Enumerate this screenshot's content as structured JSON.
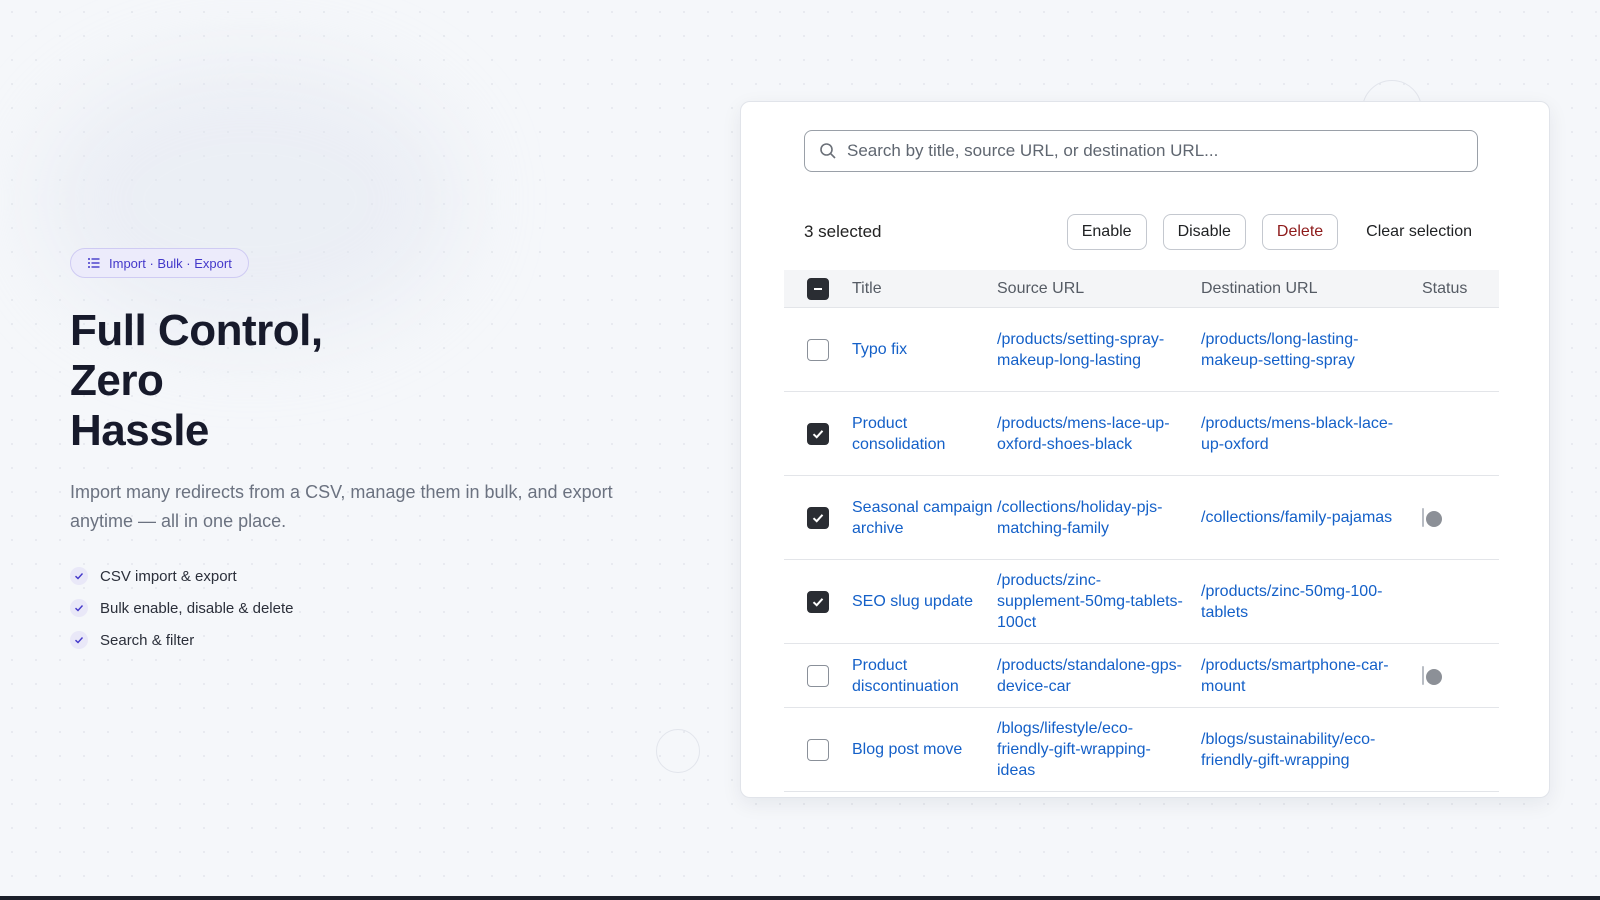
{
  "hero": {
    "chip_label": "Import · Bulk · Export",
    "chip_icon": "list-icon",
    "headline_lines": [
      "Full Control,",
      "Zero",
      "Hassle"
    ],
    "subtitle": "Import many redirects from a CSV, manage them in bulk, and export anytime — all in one place.",
    "features": [
      "CSV import & export",
      "Bulk enable, disable & delete",
      "Search & filter"
    ]
  },
  "search": {
    "placeholder": "Search by title, source URL, or destination URL..."
  },
  "bulk": {
    "selected_text": "3 selected",
    "enable_label": "Enable",
    "disable_label": "Disable",
    "delete_label": "Delete",
    "clear_label": "Clear selection"
  },
  "table": {
    "headers": {
      "title": "Title",
      "source": "Source URL",
      "destination": "Destination URL",
      "status": "Status"
    },
    "header_checkbox": "indeterminate",
    "rows": [
      {
        "title": "Typo fix",
        "source": "/products/setting-spray-makeup-long-lasting",
        "destination": "/products/long-lasting-makeup-setting-spray",
        "selected": false,
        "enabled": true
      },
      {
        "title": "Product consolidation",
        "source": "/products/mens-lace-up-oxford-shoes-black",
        "destination": "/products/mens-black-lace-up-oxford",
        "selected": true,
        "enabled": true
      },
      {
        "title": "Seasonal campaign archive",
        "source": "/collections/holiday-pjs-matching-family",
        "destination": "/collections/family-pajamas",
        "selected": true,
        "enabled": false
      },
      {
        "title": "SEO slug update",
        "source": "/products/zinc-supplement-50mg-tablets-100ct",
        "destination": "/products/zinc-50mg-100-tablets",
        "selected": true,
        "enabled": true
      },
      {
        "title": "Product discontinuation",
        "source": "/products/standalone-gps-device-car",
        "destination": "/products/smartphone-car-mount",
        "selected": false,
        "enabled": false
      },
      {
        "title": "Blog post move",
        "source": "/blogs/lifestyle/eco-friendly-gift-wrapping-ideas",
        "destination": "/blogs/sustainability/eco-friendly-gift-wrapping",
        "selected": false,
        "enabled": true
      }
    ]
  },
  "colors": {
    "accent": "#4338ca",
    "link": "#1460c8",
    "danger": "#8e1b1b",
    "toggle_on": "#2a2d33"
  }
}
